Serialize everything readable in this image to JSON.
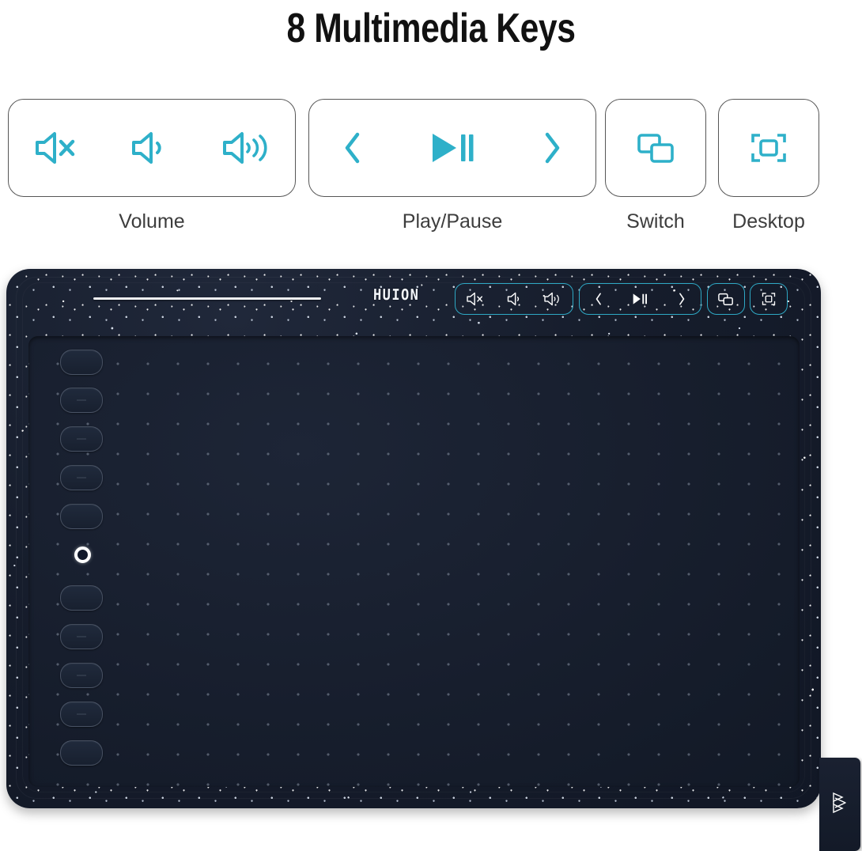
{
  "page": {
    "title": "8 Multimedia Keys",
    "background_color": "#ffffff",
    "accent_color": "#2eb0c9",
    "label_color": "#3d3d3d",
    "card_border_color": "#565656"
  },
  "feature_cards": [
    {
      "id": "volume",
      "label": "Volume",
      "keys": [
        {
          "name": "mute-icon",
          "label": "Mute"
        },
        {
          "name": "volume-down-icon",
          "label": "Volume Down"
        },
        {
          "name": "volume-up-icon",
          "label": "Volume Up"
        }
      ]
    },
    {
      "id": "play-pause",
      "label": "Play/Pause",
      "keys": [
        {
          "name": "previous-track-icon",
          "label": "Previous"
        },
        {
          "name": "play-pause-icon",
          "label": "Play/Pause"
        },
        {
          "name": "next-track-icon",
          "label": "Next"
        }
      ]
    },
    {
      "id": "switch",
      "label": "Switch",
      "keys": [
        {
          "name": "switch-window-icon",
          "label": "Switch"
        }
      ]
    },
    {
      "id": "desktop",
      "label": "Desktop",
      "keys": [
        {
          "name": "show-desktop-icon",
          "label": "Desktop"
        }
      ]
    }
  ],
  "tablet": {
    "brand": "HUION",
    "body_color": "#161d2c",
    "active_area_color": "#171e2d",
    "key_outline_color": "#2ea8c4",
    "express_keys_count": 10,
    "led_indicator": "power-led",
    "touch_strip": "touch-strip",
    "side_tab_emblem": "huion-crown-emblem",
    "top_key_groups": [
      {
        "id": "volume",
        "keys": [
          "mute-icon",
          "volume-down-icon",
          "volume-up-icon"
        ]
      },
      {
        "id": "play-pause",
        "keys": [
          "previous-track-icon",
          "play-pause-icon",
          "next-track-icon"
        ]
      },
      {
        "id": "switch",
        "keys": [
          "switch-window-icon"
        ]
      },
      {
        "id": "desktop",
        "keys": [
          "show-desktop-icon"
        ]
      }
    ]
  }
}
